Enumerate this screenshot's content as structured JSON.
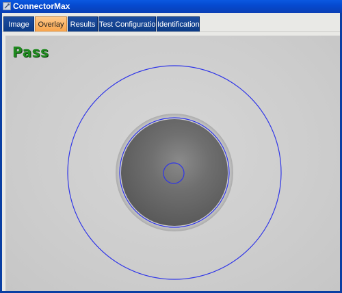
{
  "window": {
    "title": "ConnectorMax"
  },
  "tabs": [
    {
      "label": "Image",
      "active": false
    },
    {
      "label": "Overlay",
      "active": true
    },
    {
      "label": "Results",
      "active": false
    },
    {
      "label": "Test Configuration",
      "active": false
    },
    {
      "label": "Identification",
      "active": false
    }
  ],
  "overlay": {
    "result_text": "Pass",
    "result_color": "#1f8a1f",
    "ring_color": "#2f35e8"
  }
}
